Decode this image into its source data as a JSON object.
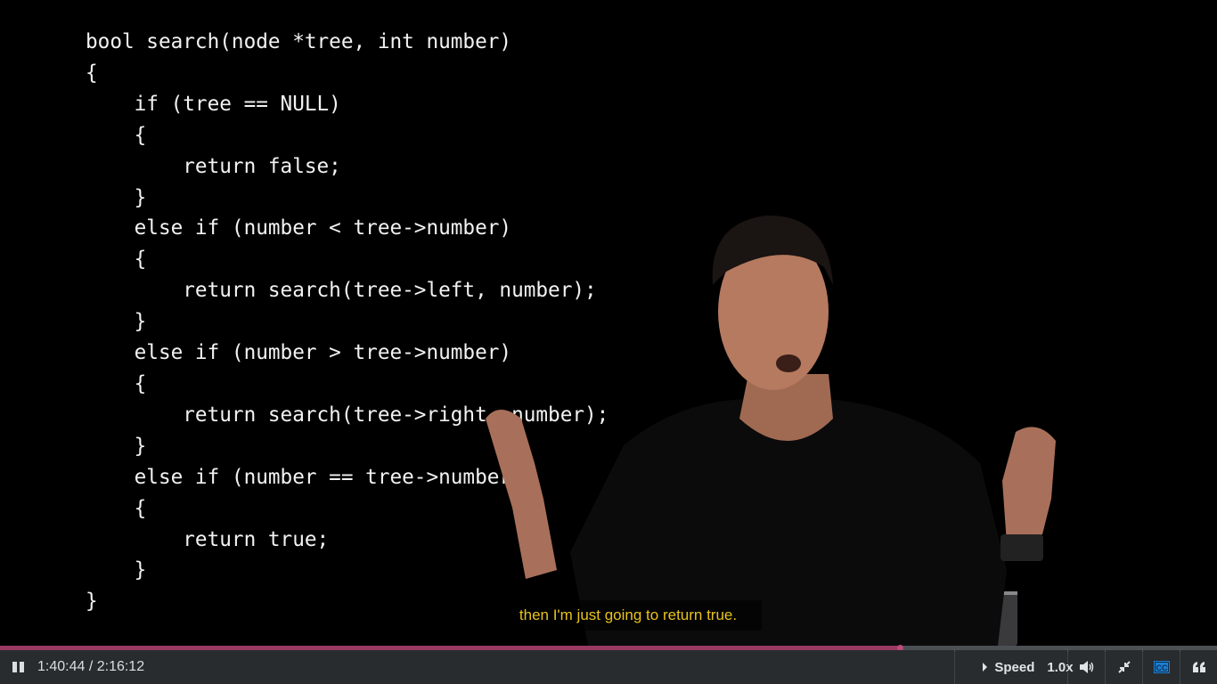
{
  "slide": {
    "code_lines": [
      "bool search(node *tree, int number)",
      "{",
      "    if (tree == NULL)",
      "    {",
      "        return false;",
      "    }",
      "    else if (number < tree->number)",
      "    {",
      "        return search(tree->left, number);",
      "    }",
      "    else if (number > tree->number)",
      "    {",
      "        return search(tree->right, number);",
      "    }",
      "    else if (number == tree->number)",
      "    {",
      "        return true;",
      "    }",
      "}"
    ]
  },
  "caption": "then I'm just going to return true.",
  "player": {
    "current_time": "1:40:44",
    "duration": "2:16:12",
    "time_display": "1:40:44 / 2:16:12",
    "progress_percent": 73.96,
    "speed_label": "Speed",
    "speed_value": "1.0x",
    "icons": [
      "pause-icon",
      "speed-arrow-icon",
      "volume-icon",
      "exit-fullscreen-icon",
      "closed-captions-icon",
      "transcript-quote-icon"
    ],
    "colors": {
      "progress": "#9a3a62",
      "caption_text": "#e8c31c",
      "cc_active": "#1e7fd0",
      "bar_bg": "#282c2f"
    }
  }
}
